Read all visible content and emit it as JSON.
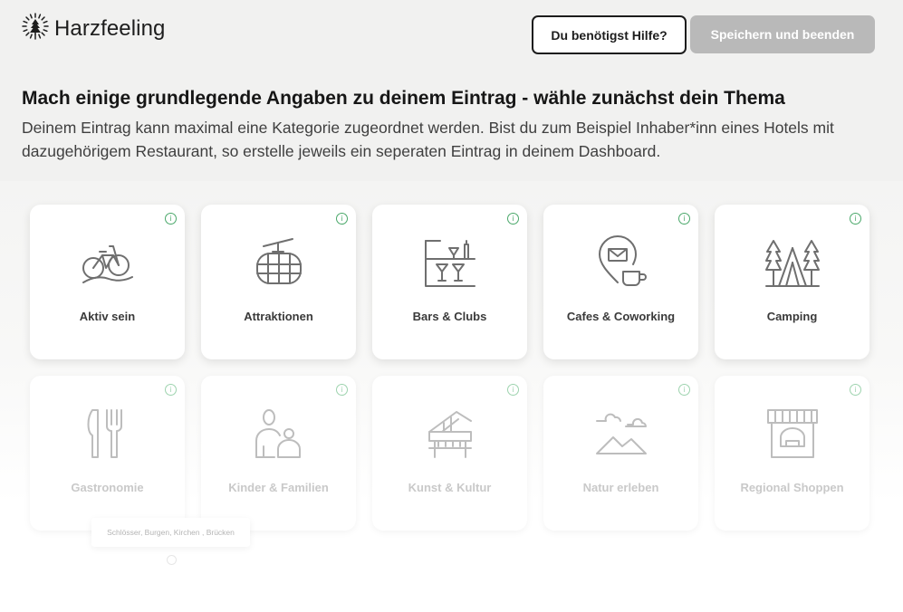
{
  "header": {
    "logo_text": "Harzfeeling",
    "help_button": "Du benötigst Hilfe?",
    "save_button": "Speichern und beenden"
  },
  "intro": {
    "title": "Mach einige grundlegende Angaben zu deinem Eintrag - wähle zunächst dein Thema",
    "description": "Deinem Eintrag kann maximal eine Kategorie zugeordnet werden. Bist du zum Beispiel Inhaber*inn eines Hotels mit dazugehörigem Restaurant, so erstelle jeweils ein seperaten Eintrag in deinem Dashboard."
  },
  "categories": [
    {
      "label": "Aktiv sein",
      "icon": "bicycle-icon"
    },
    {
      "label": "Attraktionen",
      "icon": "cable-car-icon"
    },
    {
      "label": "Bars & Clubs",
      "icon": "bar-icon"
    },
    {
      "label": "Cafes & Coworking",
      "icon": "cafe-location-icon"
    },
    {
      "label": "Camping",
      "icon": "tent-trees-icon"
    },
    {
      "label": "Gastronomie",
      "icon": "fork-knife-icon"
    },
    {
      "label": "Kinder & Familien",
      "icon": "family-icon"
    },
    {
      "label": "Kunst & Kultur",
      "icon": "piano-icon"
    },
    {
      "label": "Natur erleben",
      "icon": "mountains-clouds-icon"
    },
    {
      "label": "Regional Shoppen",
      "icon": "shop-icon"
    }
  ],
  "info_glyph": "i",
  "tooltip": "Schlösser, Burgen, Kirchen , Brücken",
  "colors": {
    "background": "#f1f1f0",
    "save_button_disabled": "#b9b9b9",
    "info_green": "#4aa86a",
    "icon_gray": "#6f6f6f",
    "icon_faded": "#bdbdbd"
  }
}
